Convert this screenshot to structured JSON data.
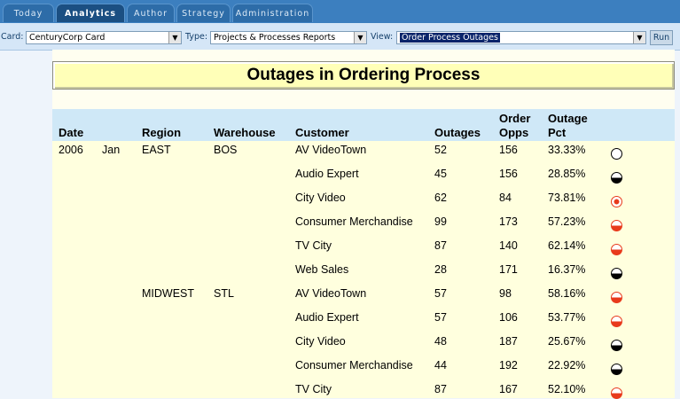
{
  "tabs": [
    {
      "label": "Today",
      "active": false
    },
    {
      "label": "Analytics",
      "active": true
    },
    {
      "label": "Author",
      "active": false
    },
    {
      "label": "Strategy",
      "active": false
    },
    {
      "label": "Administration",
      "active": false
    }
  ],
  "toolbar": {
    "card_label": "Card:",
    "card_value": "CenturyCorp Card",
    "type_label": "Type:",
    "type_value": "Projects & Processes Reports",
    "view_label": "View:",
    "view_value": "Order Process Outages",
    "run_label": "Run"
  },
  "report": {
    "title": "Outages in Ordering Process",
    "columns": {
      "date": "Date",
      "region": "Region",
      "warehouse": "Warehouse",
      "customer": "Customer",
      "outages": "Outages",
      "order_opps_1": "Order",
      "order_opps_2": "Opps",
      "outage_pct_1": "Outage",
      "outage_pct_2": "Pct"
    },
    "rows": [
      {
        "year": "2006",
        "month": "Jan",
        "region": "EAST",
        "warehouse": "BOS",
        "customer": "AV VideoTown",
        "outages": "52",
        "opps": "156",
        "pct": "33.33%",
        "status": "white"
      },
      {
        "year": "",
        "month": "",
        "region": "",
        "warehouse": "",
        "customer": "Audio Expert",
        "outages": "45",
        "opps": "156",
        "pct": "28.85%",
        "status": "half-black"
      },
      {
        "year": "",
        "month": "",
        "region": "",
        "warehouse": "",
        "customer": "City Video",
        "outages": "62",
        "opps": "84",
        "pct": "73.81%",
        "status": "red-dot"
      },
      {
        "year": "",
        "month": "",
        "region": "",
        "warehouse": "",
        "customer": "Consumer Merchandise",
        "outages": "99",
        "opps": "173",
        "pct": "57.23%",
        "status": "half-red"
      },
      {
        "year": "",
        "month": "",
        "region": "",
        "warehouse": "",
        "customer": "TV City",
        "outages": "87",
        "opps": "140",
        "pct": "62.14%",
        "status": "half-red"
      },
      {
        "year": "",
        "month": "",
        "region": "",
        "warehouse": "",
        "customer": "Web Sales",
        "outages": "28",
        "opps": "171",
        "pct": "16.37%",
        "status": "half-black"
      },
      {
        "year": "",
        "month": "",
        "region": "MIDWEST",
        "warehouse": "STL",
        "customer": "AV VideoTown",
        "outages": "57",
        "opps": "98",
        "pct": "58.16%",
        "status": "half-red"
      },
      {
        "year": "",
        "month": "",
        "region": "",
        "warehouse": "",
        "customer": "Audio Expert",
        "outages": "57",
        "opps": "106",
        "pct": "53.77%",
        "status": "half-red"
      },
      {
        "year": "",
        "month": "",
        "region": "",
        "warehouse": "",
        "customer": "City Video",
        "outages": "48",
        "opps": "187",
        "pct": "25.67%",
        "status": "half-black"
      },
      {
        "year": "",
        "month": "",
        "region": "",
        "warehouse": "",
        "customer": "Consumer Merchandise",
        "outages": "44",
        "opps": "192",
        "pct": "22.92%",
        "status": "half-black"
      },
      {
        "year": "",
        "month": "",
        "region": "",
        "warehouse": "",
        "customer": "TV City",
        "outages": "87",
        "opps": "167",
        "pct": "52.10%",
        "status": "half-red"
      }
    ]
  },
  "colors": {
    "status_red": "#e83a1c",
    "status_black": "#000000"
  }
}
